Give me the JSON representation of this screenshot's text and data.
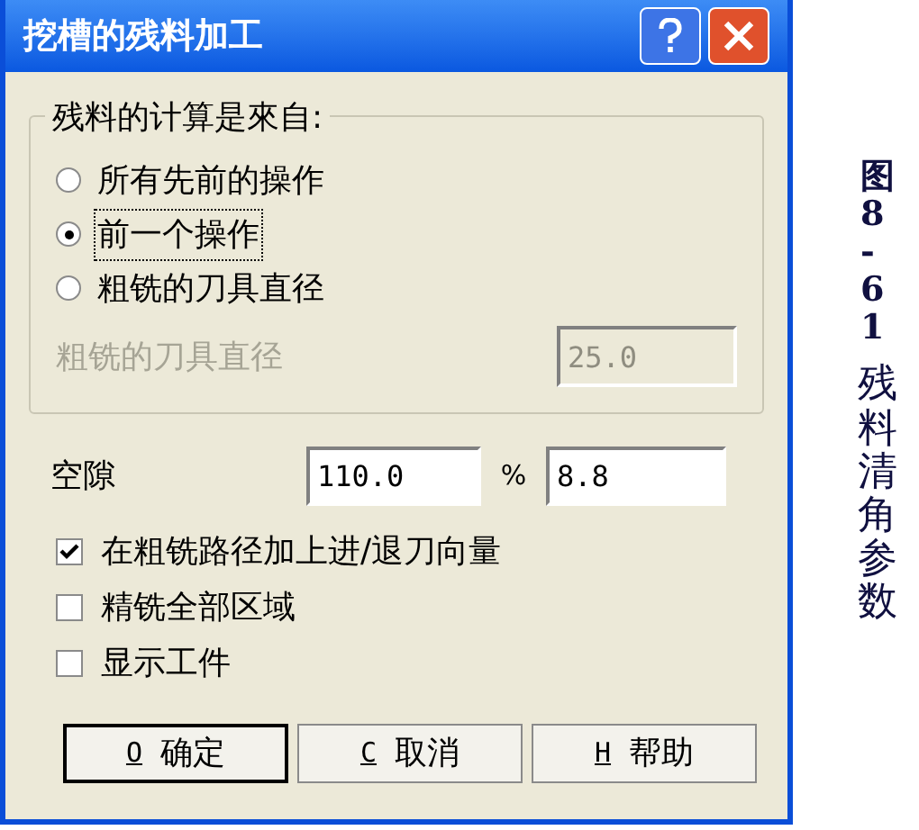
{
  "window": {
    "title": "挖槽的残料加工"
  },
  "group": {
    "label": "残料的计算是來自:",
    "radios": [
      {
        "label": "所有先前的操作",
        "selected": false
      },
      {
        "label": "前一个操作",
        "selected": true
      },
      {
        "label": "粗铣的刀具直径",
        "selected": false
      }
    ],
    "diameter": {
      "label": "粗铣的刀具直径",
      "value": "25.0",
      "disabled": true
    }
  },
  "clearance": {
    "label": "空隙",
    "percent": "110.0",
    "unit": "%",
    "value": "8.8"
  },
  "checkboxes": [
    {
      "label": "在粗铣路径加上进/退刀向量",
      "checked": true
    },
    {
      "label": "精铣全部区域",
      "checked": false
    },
    {
      "label": "显示工件",
      "checked": false
    }
  ],
  "buttons": [
    {
      "key": "O",
      "label": "确定",
      "default": true
    },
    {
      "key": "C",
      "label": "取消",
      "default": false
    },
    {
      "key": "H",
      "label": "帮助",
      "default": false
    }
  ],
  "caption": {
    "number": "图8-61",
    "text": "残料清角参数"
  }
}
